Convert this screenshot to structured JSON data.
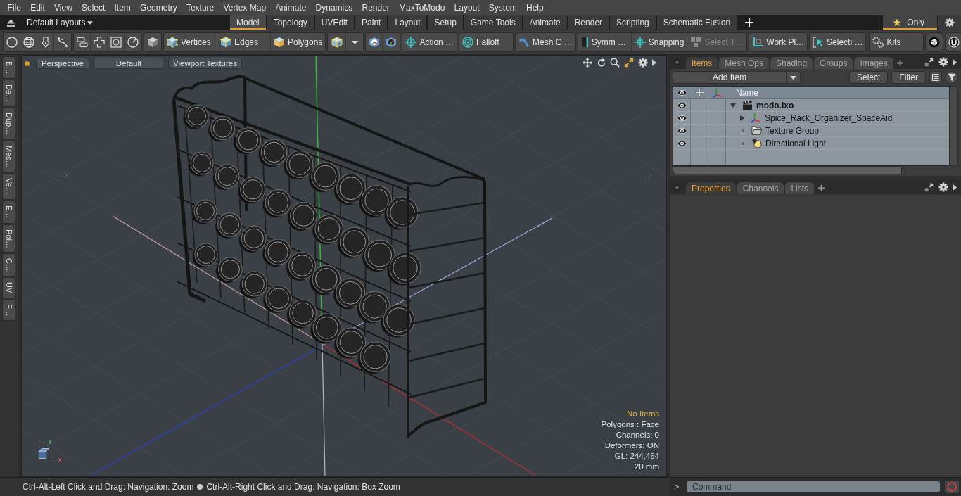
{
  "menu_bar": {
    "items": [
      "File",
      "Edit",
      "View",
      "Select",
      "Item",
      "Geometry",
      "Texture",
      "Vertex Map",
      "Animate",
      "Dynamics",
      "Render",
      "MaxToModo",
      "Layout",
      "System",
      "Help"
    ]
  },
  "layout_bar": {
    "layouts_menu": "Default Layouts",
    "tabs": [
      {
        "label": "Model",
        "selected": true
      },
      {
        "label": "Topology",
        "selected": false
      },
      {
        "label": "UVEdit",
        "selected": false
      },
      {
        "label": "Paint",
        "selected": false
      },
      {
        "label": "Layout",
        "selected": false
      },
      {
        "label": "Setup",
        "selected": false
      },
      {
        "label": "Game Tools",
        "selected": false
      },
      {
        "label": "Animate",
        "selected": false
      },
      {
        "label": "Render",
        "selected": false
      },
      {
        "label": "Scripting",
        "selected": false
      },
      {
        "label": "Schematic Fusion",
        "selected": false
      }
    ],
    "only_toggle": {
      "label": "Only",
      "selected": true
    }
  },
  "toolbar": {
    "buttons": [
      {
        "label": "Vertices",
        "disabled": false
      },
      {
        "label": "Edges",
        "disabled": false
      },
      {
        "label": "Polygons",
        "disabled": false
      },
      {
        "label": "Action …",
        "disabled": false
      },
      {
        "label": "Falloff",
        "disabled": false
      },
      {
        "label": "Mesh C …",
        "disabled": false
      },
      {
        "label": "Symm …",
        "disabled": false
      },
      {
        "label": "Snapping",
        "disabled": false
      },
      {
        "label": "Select T…",
        "disabled": true
      },
      {
        "label": "Work Pl…",
        "disabled": false
      },
      {
        "label": "Selecti …",
        "disabled": false
      },
      {
        "label": "Kits",
        "disabled": false
      }
    ]
  },
  "left_sidebar": {
    "tabs": [
      "B…",
      "De…",
      "Dup…",
      "Mes…",
      "Ve…",
      "E…",
      "Pol…",
      "C…",
      "UV",
      "F…"
    ]
  },
  "viewport": {
    "header_buttons": [
      "Perspective",
      "Default",
      "Viewport Textures"
    ],
    "axis_labels": [
      "-X",
      "-Z"
    ],
    "gizmo_labels": [
      "Y",
      "X"
    ],
    "info": [
      {
        "text": "No Items",
        "kind": "highlight"
      },
      {
        "text": "Polygons : Face",
        "kind": "plain"
      },
      {
        "text": "Channels: 0",
        "kind": "plain"
      },
      {
        "text": "Deformers: ON",
        "kind": "plain"
      },
      {
        "text": "GL: 244,464",
        "kind": "plain"
      },
      {
        "text": "20 mm",
        "kind": "plain"
      }
    ]
  },
  "items_panel": {
    "tabs": [
      {
        "label": "Items",
        "selected": true
      },
      {
        "label": "Mesh Ops",
        "selected": false
      },
      {
        "label": "Shading",
        "selected": false
      },
      {
        "label": "Groups",
        "selected": false
      },
      {
        "label": "Images",
        "selected": false
      }
    ],
    "add_item": "Add Item",
    "buttons": [
      "Select",
      "Filter"
    ],
    "name_column": "Name",
    "tree": [
      {
        "label": "modo.lxo",
        "kind": "scene",
        "visible": true,
        "expanded": true,
        "children": [
          {
            "label": "Spice_Rack_Organizer_SpaceAid",
            "kind": "mesh",
            "visible": true,
            "expanded": false
          },
          {
            "label": "Texture Group",
            "kind": "group",
            "visible": true
          },
          {
            "label": "Directional Light",
            "kind": "light",
            "visible": true
          }
        ]
      }
    ]
  },
  "properties_panel": {
    "tabs": [
      {
        "label": "Properties",
        "selected": true
      },
      {
        "label": "Channels",
        "selected": false
      },
      {
        "label": "Lists",
        "selected": false
      }
    ]
  },
  "status_bar": {
    "hints": [
      "Ctrl-Alt-Left Click and Drag: Navigation: Zoom",
      "Ctrl-Alt-Right Click and Drag: Navigation: Box Zoom"
    ],
    "command": {
      "prompt": ">",
      "placeholder": "Command"
    }
  }
}
